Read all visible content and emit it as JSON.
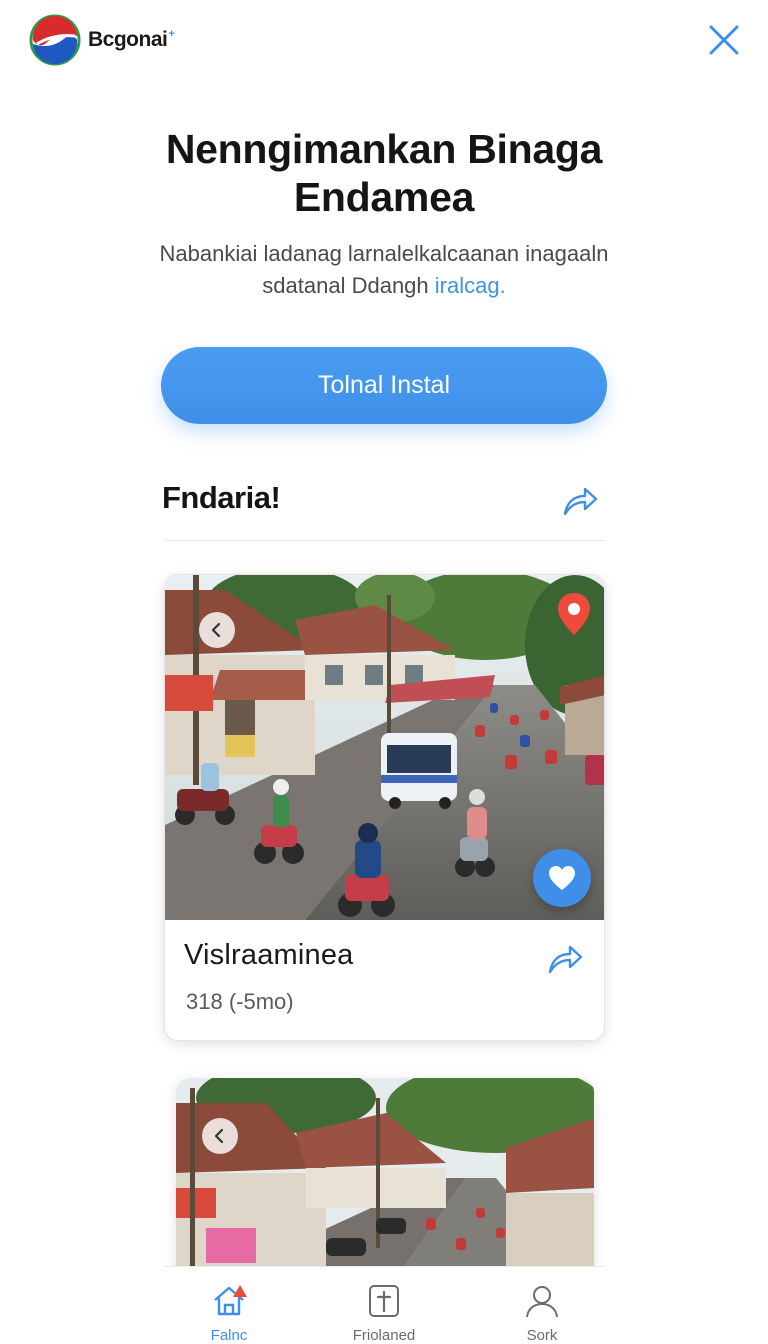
{
  "header": {
    "brand_name": "Bcgonai",
    "brand_sup": "+",
    "logo_icon": "brand-globe-logo",
    "close_icon": "close-icon"
  },
  "hero": {
    "title_line1": "Nenngimankan Binaga",
    "title_line2": "Endamea",
    "subtitle_line1": "Nabankiai ladanag larnalelkalcaanan inagaaln",
    "subtitle_line2_text": "sdatanal Ddangh ",
    "subtitle_line2_link": "iralcag."
  },
  "cta": {
    "label": "Tolnal Instal"
  },
  "section": {
    "title": "Fndaria!",
    "share_icon": "share-arrow-icon"
  },
  "listing": {
    "name": "Vislraaminea",
    "meta": "318 (-5mo)",
    "prev_icon": "chevron-left-icon",
    "pin_icon": "location-pin-icon",
    "favorite_icon": "heart-icon"
  },
  "bottom_nav": {
    "items": [
      {
        "label": "Falnc",
        "icon": "home-icon",
        "active": true
      },
      {
        "label": "Friolaned",
        "icon": "bookmark-plus-icon",
        "active": false
      },
      {
        "label": "Sork",
        "icon": "user-icon",
        "active": false
      }
    ]
  },
  "colors": {
    "accent": "#3f8fe9",
    "pin": "#ef4b3c",
    "text": "#151515"
  }
}
